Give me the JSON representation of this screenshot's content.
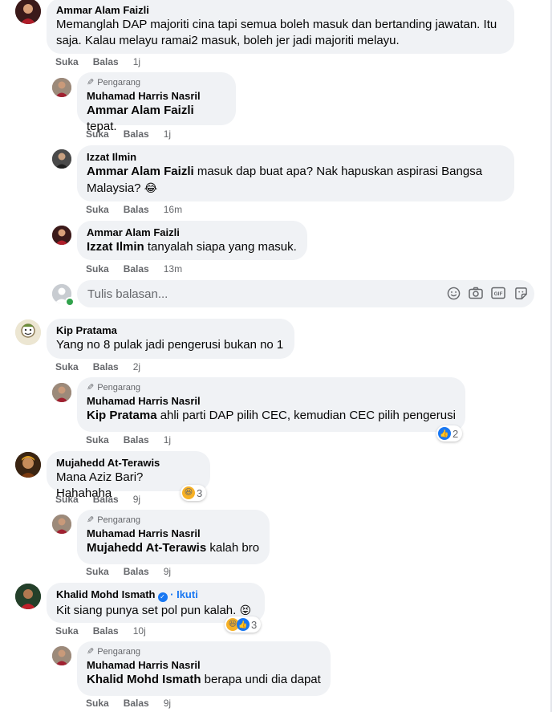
{
  "labels": {
    "like": "Suka",
    "reply": "Balas",
    "author_tag": "Pengarang",
    "follow": "Ikuti",
    "follow_sep": "·"
  },
  "comments": [
    {
      "author": "Ammar Alam Faizli",
      "text": "Memanglah DAP majoriti cina tapi semua boleh masuk dan bertanding jawatan. Itu saja. Kalau melayu ramai2 masuk, boleh jer jadi majoriti melayu.",
      "time": "1j"
    },
    {
      "author": "Muhamad Harris Nasril",
      "mention": "Ammar Alam Faizli",
      "text": " tepat.",
      "time": "1j"
    },
    {
      "author": "Izzat Ilmin",
      "mention": "Ammar Alam Faizli",
      "text": " masuk dap buat apa? Nak hapuskan aspirasi Bangsa Malaysia?",
      "emoji": "😂",
      "time": "16m"
    },
    {
      "author": "Ammar Alam Faizli",
      "mention": "Izzat Ilmin",
      "text": " tanyalah siapa yang masuk.",
      "time": "13m"
    },
    {
      "author": "Kip Pratama",
      "text": "Yang no 8 pulak jadi pengerusi bukan no 1",
      "time": "2j"
    },
    {
      "author": "Muhamad Harris Nasril",
      "mention": "Kip Pratama",
      "text": " ahli parti DAP pilih CEC, kemudian CEC pilih pengerusi",
      "time": "1j",
      "reactions": "2"
    },
    {
      "author": "Mujahedd At-Terawis",
      "text": "Mana Aziz Bari? Hahahaha",
      "time": "9j",
      "reactions": "3"
    },
    {
      "author": "Muhamad Harris Nasril",
      "mention": "Mujahedd At-Terawis",
      "text": " kalah bro",
      "time": "9j"
    },
    {
      "author": "Khalid Mohd Ismath",
      "text": "Kit siang punya set pol pun kalah.",
      "emoji": "😝",
      "time": "10j",
      "reactions": "3"
    },
    {
      "author": "Muhamad Harris Nasril",
      "mention": "Khalid Mohd Ismath",
      "text": " berapa undi dia dapat",
      "time": "9j"
    }
  ],
  "reply_input": {
    "placeholder": "Tulis balasan..."
  },
  "icons": [
    "smiley-icon",
    "camera-icon",
    "gif-icon",
    "sticker-icon",
    "pencil-icon",
    "verified-icon",
    "like-reaction-icon",
    "haha-reaction-icon"
  ],
  "colors": {
    "bubble": "#f0f2f5",
    "meta": "#65676b",
    "link": "#1877f2"
  }
}
